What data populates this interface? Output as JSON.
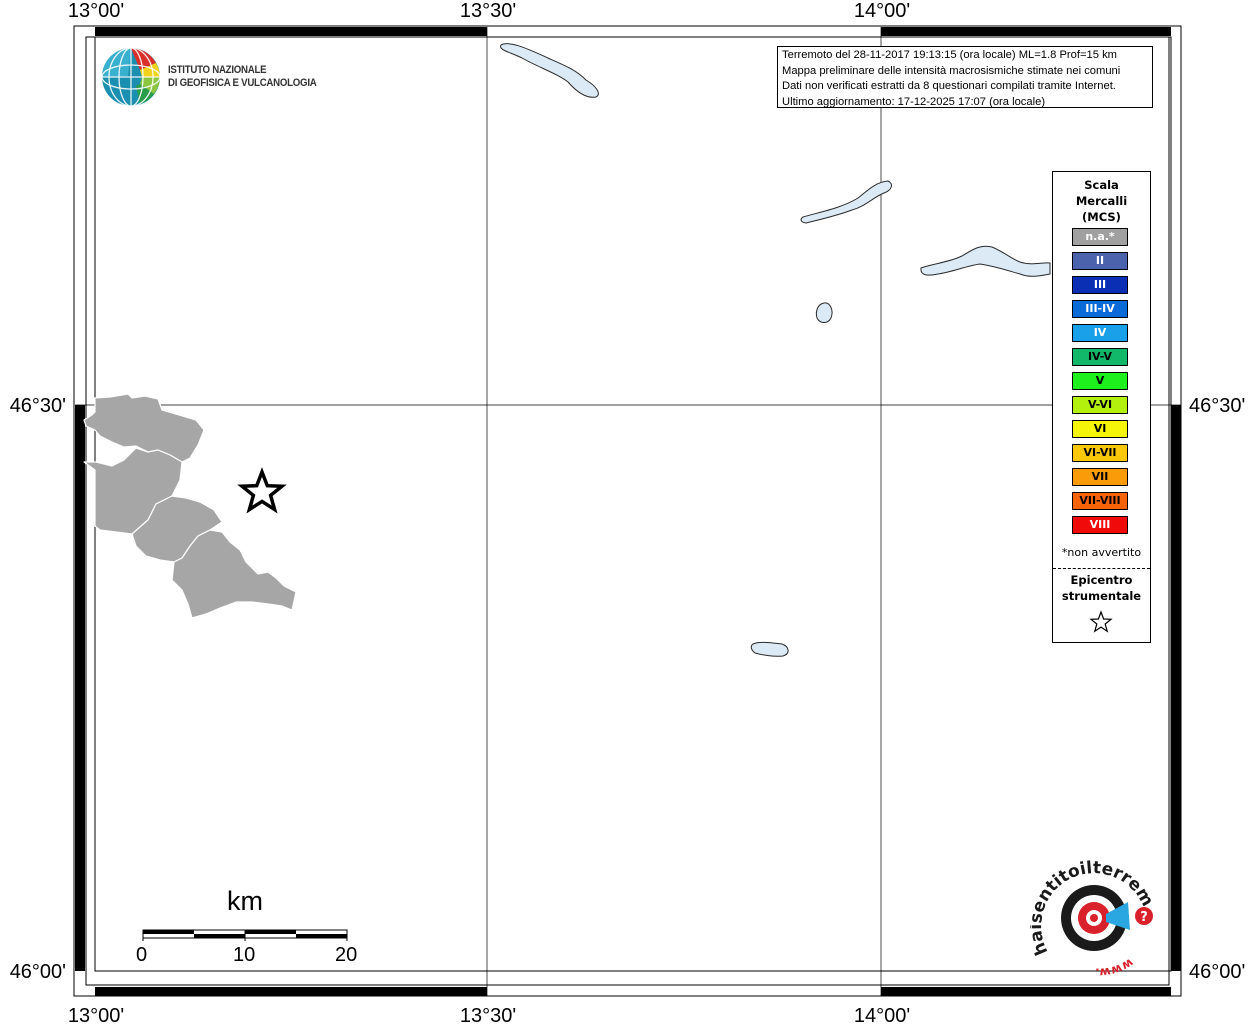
{
  "axes": {
    "longitude_labels": [
      "13°00'",
      "13°30'",
      "14°00'"
    ],
    "latitude_labels": [
      "46°30'",
      "46°00'"
    ]
  },
  "header": {
    "institute_line1": "ISTITUTO NAZIONALE",
    "institute_line2": "DI GEOFISICA E VULCANOLOGIA"
  },
  "info": {
    "line1": "Terremoto del 28-11-2017 19:13:15 (ora locale) ML=1.8 Prof=15 km",
    "line2": "Mappa preliminare delle intensità macrosismiche stimate nei comuni",
    "line3": "Dati non verificati estratti da 8 questionari compilati tramite Internet.",
    "line4": "Ultimo aggiornamento: 17-12-2025 17:07 (ora locale)"
  },
  "legend": {
    "title_line1": "Scala",
    "title_line2": "Mercalli",
    "title_line3": "(MCS)",
    "items": [
      {
        "label": "n.a.*",
        "color": "#a0a0a0",
        "text_color": "#ffffff"
      },
      {
        "label": "II",
        "color": "#4b62ad",
        "text_color": "#ffffff"
      },
      {
        "label": "III",
        "color": "#0a2fb4",
        "text_color": "#ffffff"
      },
      {
        "label": "III-IV",
        "color": "#0a6ad8",
        "text_color": "#ffffff"
      },
      {
        "label": "IV",
        "color": "#1aa0e8",
        "text_color": "#ffffff"
      },
      {
        "label": "IV-V",
        "color": "#12b86a",
        "text_color": "#000000"
      },
      {
        "label": "V",
        "color": "#1ef01e",
        "text_color": "#000000"
      },
      {
        "label": "V-VI",
        "color": "#b4f00e",
        "text_color": "#000000"
      },
      {
        "label": "VI",
        "color": "#f5f50a",
        "text_color": "#000000"
      },
      {
        "label": "VI-VII",
        "color": "#fac80a",
        "text_color": "#000000"
      },
      {
        "label": "VII",
        "color": "#fa9b0a",
        "text_color": "#000000"
      },
      {
        "label": "VII-VIII",
        "color": "#f5640a",
        "text_color": "#000000"
      },
      {
        "label": "VIII",
        "color": "#f00a0a",
        "text_color": "#ffffff"
      }
    ],
    "note": "*non avvertito",
    "epicenter_line1": "Epicentro",
    "epicenter_line2": "strumentale"
  },
  "scalebar": {
    "unit": "km",
    "labels": [
      "0",
      "10",
      "20"
    ]
  },
  "watermark": {
    "text": "haisentitoilterremoto.it",
    "prefix": "www."
  },
  "colors": {
    "municipality_fill": "#a6a6a6",
    "lake_fill": "#dbeaf5",
    "epicenter_star": "#000000"
  }
}
